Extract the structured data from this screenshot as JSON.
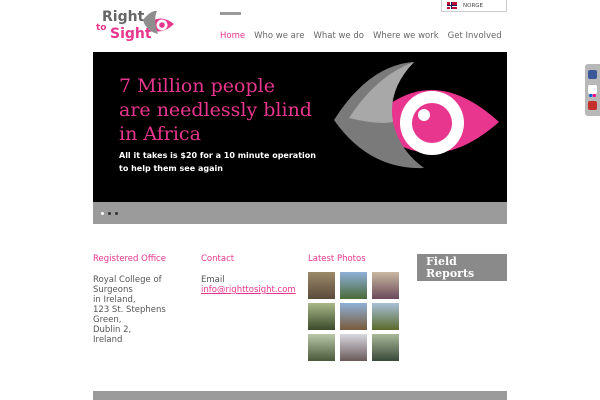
{
  "logo": {
    "line1": "Right",
    "line2": "to",
    "line3": "Sight"
  },
  "language": {
    "label": "NORGE"
  },
  "nav": {
    "items": [
      "Home",
      "Who we are",
      "What we do",
      "Where we work",
      "Get Involved"
    ],
    "active": "Home"
  },
  "hero": {
    "headline": [
      "7 Million people",
      "are needlessly blind",
      "in Africa"
    ],
    "subline": [
      "All it takes is $20 for a 10 minute operation",
      "to help them see again"
    ]
  },
  "slider": {
    "slides": 3,
    "active_index": 1
  },
  "footer": {
    "office": {
      "title": "Registered Office",
      "lines": [
        "Royal College of",
        "Surgeons",
        "in Ireland,",
        "123 St. Stephens",
        "Green,",
        "Dublin 2,",
        "Ireland"
      ]
    },
    "contact": {
      "title": "Contact",
      "email_label": "Email",
      "email": "info@righttosight.com"
    },
    "photos": {
      "title": "Latest Photos"
    },
    "field_reports": {
      "lines": [
        "Field",
        "Reports"
      ]
    }
  },
  "social": [
    "facebook-icon",
    "flickr-icon",
    "youtube-icon"
  ],
  "colors": {
    "accent": "#e8368f",
    "grey": "#9b9b9b",
    "hero_bg": "#000000"
  }
}
